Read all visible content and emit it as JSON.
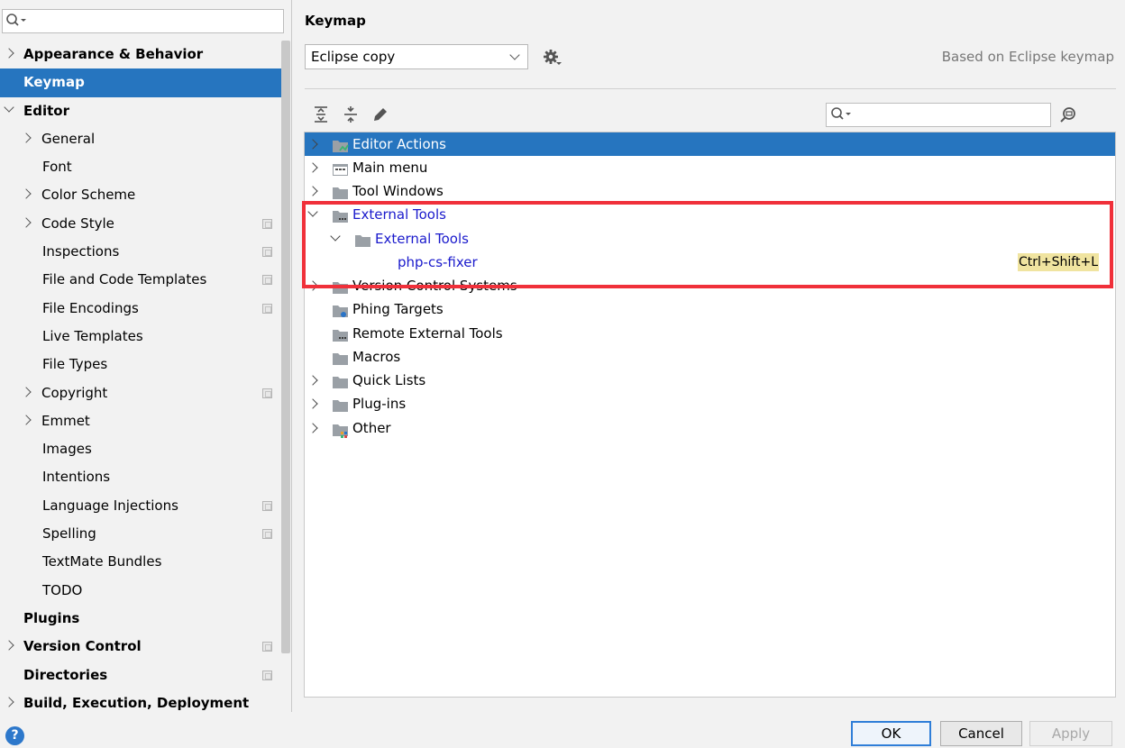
{
  "sidebar": {
    "search": {
      "placeholder": ""
    },
    "items": [
      {
        "label": "Appearance & Behavior",
        "level": 0,
        "arrow": "right",
        "proj": false,
        "selected": false
      },
      {
        "label": "Keymap",
        "level": 0,
        "arrow": "none",
        "proj": false,
        "selected": true
      },
      {
        "label": "Editor",
        "level": 0,
        "arrow": "down",
        "proj": false,
        "selected": false
      },
      {
        "label": "General",
        "level": 1,
        "arrow": "right",
        "proj": false,
        "selected": false
      },
      {
        "label": "Font",
        "level": 1,
        "arrow": "none",
        "proj": false,
        "selected": false
      },
      {
        "label": "Color Scheme",
        "level": 1,
        "arrow": "right",
        "proj": false,
        "selected": false
      },
      {
        "label": "Code Style",
        "level": 1,
        "arrow": "right",
        "proj": true,
        "selected": false
      },
      {
        "label": "Inspections",
        "level": 1,
        "arrow": "none",
        "proj": true,
        "selected": false
      },
      {
        "label": "File and Code Templates",
        "level": 1,
        "arrow": "none",
        "proj": true,
        "selected": false
      },
      {
        "label": "File Encodings",
        "level": 1,
        "arrow": "none",
        "proj": true,
        "selected": false
      },
      {
        "label": "Live Templates",
        "level": 1,
        "arrow": "none",
        "proj": false,
        "selected": false
      },
      {
        "label": "File Types",
        "level": 1,
        "arrow": "none",
        "proj": false,
        "selected": false
      },
      {
        "label": "Copyright",
        "level": 1,
        "arrow": "right",
        "proj": true,
        "selected": false
      },
      {
        "label": "Emmet",
        "level": 1,
        "arrow": "right",
        "proj": false,
        "selected": false
      },
      {
        "label": "Images",
        "level": 1,
        "arrow": "none",
        "proj": false,
        "selected": false
      },
      {
        "label": "Intentions",
        "level": 1,
        "arrow": "none",
        "proj": false,
        "selected": false
      },
      {
        "label": "Language Injections",
        "level": 1,
        "arrow": "none",
        "proj": true,
        "selected": false
      },
      {
        "label": "Spelling",
        "level": 1,
        "arrow": "none",
        "proj": true,
        "selected": false
      },
      {
        "label": "TextMate Bundles",
        "level": 1,
        "arrow": "none",
        "proj": false,
        "selected": false
      },
      {
        "label": "TODO",
        "level": 1,
        "arrow": "none",
        "proj": false,
        "selected": false
      },
      {
        "label": "Plugins",
        "level": 0,
        "arrow": "none",
        "proj": false,
        "selected": false
      },
      {
        "label": "Version Control",
        "level": 0,
        "arrow": "right",
        "proj": true,
        "selected": false
      },
      {
        "label": "Directories",
        "level": 0,
        "arrow": "none",
        "proj": true,
        "selected": false
      },
      {
        "label": "Build, Execution, Deployment",
        "level": 0,
        "arrow": "right",
        "proj": false,
        "selected": false
      }
    ]
  },
  "main": {
    "title": "Keymap",
    "keymap_value": "Eclipse copy",
    "based_on": "Based on Eclipse keymap",
    "tree_search": {
      "placeholder": ""
    }
  },
  "tree": {
    "rows": [
      {
        "label": "Editor Actions",
        "depth": 0,
        "arrow": "right",
        "icon": "folder-actions",
        "selected": true,
        "blue": false,
        "shortcut": ""
      },
      {
        "label": "Main menu",
        "depth": 0,
        "arrow": "right",
        "icon": "menu",
        "selected": false,
        "blue": false,
        "shortcut": ""
      },
      {
        "label": "Tool Windows",
        "depth": 0,
        "arrow": "right",
        "icon": "folder",
        "selected": false,
        "blue": false,
        "shortcut": ""
      },
      {
        "label": "External Tools",
        "depth": 0,
        "arrow": "down",
        "icon": "folder-tools",
        "selected": false,
        "blue": true,
        "shortcut": ""
      },
      {
        "label": "External Tools",
        "depth": 1,
        "arrow": "down",
        "icon": "folder",
        "selected": false,
        "blue": true,
        "shortcut": ""
      },
      {
        "label": "php-cs-fixer",
        "depth": 2,
        "arrow": "none",
        "icon": "none",
        "selected": false,
        "blue": true,
        "shortcut": "Ctrl+Shift+L"
      },
      {
        "label": "Version Control Systems",
        "depth": 0,
        "arrow": "right",
        "icon": "folder",
        "selected": false,
        "blue": false,
        "shortcut": ""
      },
      {
        "label": "Phing Targets",
        "depth": 0,
        "arrow": "none",
        "icon": "folder-phing",
        "selected": false,
        "blue": false,
        "shortcut": ""
      },
      {
        "label": "Remote External Tools",
        "depth": 0,
        "arrow": "none",
        "icon": "folder-tools",
        "selected": false,
        "blue": false,
        "shortcut": ""
      },
      {
        "label": "Macros",
        "depth": 0,
        "arrow": "none",
        "icon": "folder",
        "selected": false,
        "blue": false,
        "shortcut": ""
      },
      {
        "label": "Quick Lists",
        "depth": 0,
        "arrow": "right",
        "icon": "folder",
        "selected": false,
        "blue": false,
        "shortcut": ""
      },
      {
        "label": "Plug-ins",
        "depth": 0,
        "arrow": "right",
        "icon": "folder",
        "selected": false,
        "blue": false,
        "shortcut": ""
      },
      {
        "label": "Other",
        "depth": 0,
        "arrow": "right",
        "icon": "folder-other",
        "selected": false,
        "blue": false,
        "shortcut": ""
      }
    ]
  },
  "buttons": {
    "ok": "OK",
    "cancel": "Cancel",
    "apply": "Apply",
    "help": "?"
  },
  "colors": {
    "selection": "#2675bf",
    "highlight_border": "#f0303a",
    "shortcut_bg": "#f0e4a0",
    "link_blue": "#1a1acc"
  }
}
